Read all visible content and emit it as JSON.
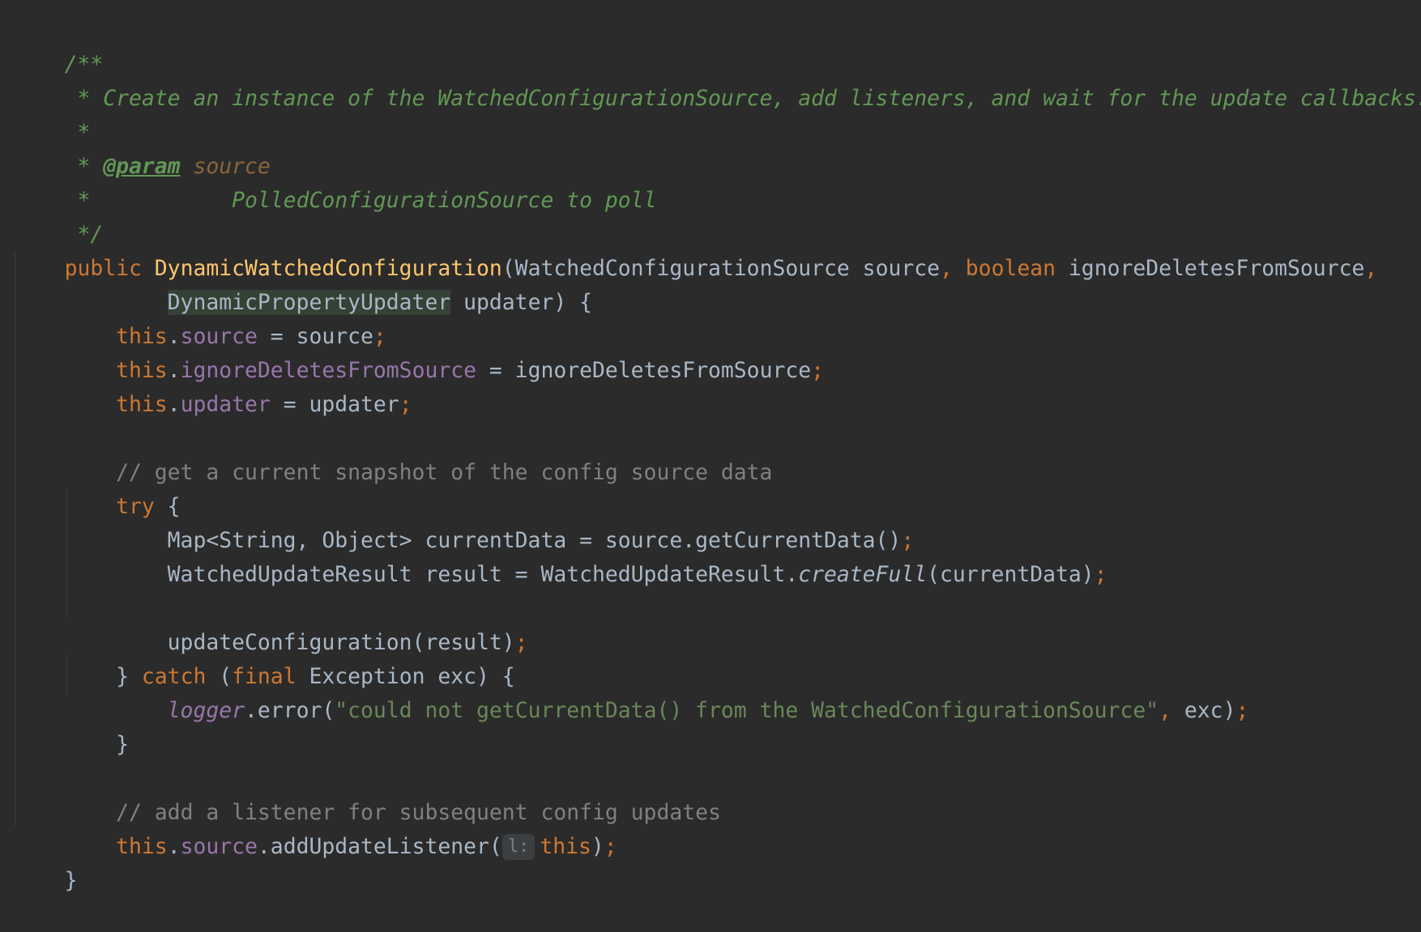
{
  "doc": {
    "open": "/**",
    "line1": " * Create an instance of the WatchedConfigurationSource, add listeners, and wait for the update callbacks.",
    "line2": " *",
    "param_prefix": " * ",
    "param_tag": "@param",
    "param_name": "source",
    "param_desc_prefix": " *",
    "param_desc": "PolledConfigurationSource to poll",
    "close": " */"
  },
  "signature": {
    "kw_public": "public",
    "method_name": "DynamicWatchedConfiguration",
    "params_start": "(WatchedConfigurationSource source",
    "kw_boolean": "boolean",
    "param2": "ignoreDeletesFromSource",
    "type_highlighted": "DynamicPropertyUpdater",
    "params_end": "updater) {"
  },
  "body": {
    "this": "this",
    "field_source": "source",
    "field_ignore": "ignoreDeletesFromSource",
    "field_updater": "updater",
    "assign_source": " = source",
    "assign_ignore": " = ignoreDeletesFromSource",
    "assign_updater": " = updater",
    "comment1": "// get a current snapshot of the config source data",
    "kw_try": "try",
    "open_brace": " {",
    "map_line": "Map<String, Object> currentData = source.getCurrentData()",
    "result_decl": "WatchedUpdateResult result = WatchedUpdateResult.",
    "create_full": "createFull",
    "result_args": "(currentData)",
    "update_call": "updateConfiguration(result)",
    "close_brace": "} ",
    "kw_catch": "catch",
    "catch_open": " (",
    "kw_final": "final",
    "catch_rest": " Exception exc) {",
    "logger": "logger",
    "error_call": ".error(",
    "error_string": "\"could not getCurrentData() from the WatchedConfigurationSource\"",
    "error_rest": " exc)",
    "inner_close": "}",
    "comment2": "// add a listener for subsequent config updates",
    "add_listener": ".addUpdateListener(",
    "hint_label": "l:",
    "end_call": ")",
    "outer_close": "}"
  },
  "punct": {
    "semicolon": ";",
    "comma": ","
  },
  "colors": {
    "background": "#2b2b2b",
    "default_text": "#a9b7c6",
    "keyword": "#cc7832",
    "method_declaration": "#ffc66d",
    "field": "#9876aa",
    "comment": "#808080",
    "doc_comment": "#629755",
    "string": "#6a8759",
    "highlight": "#344134"
  }
}
